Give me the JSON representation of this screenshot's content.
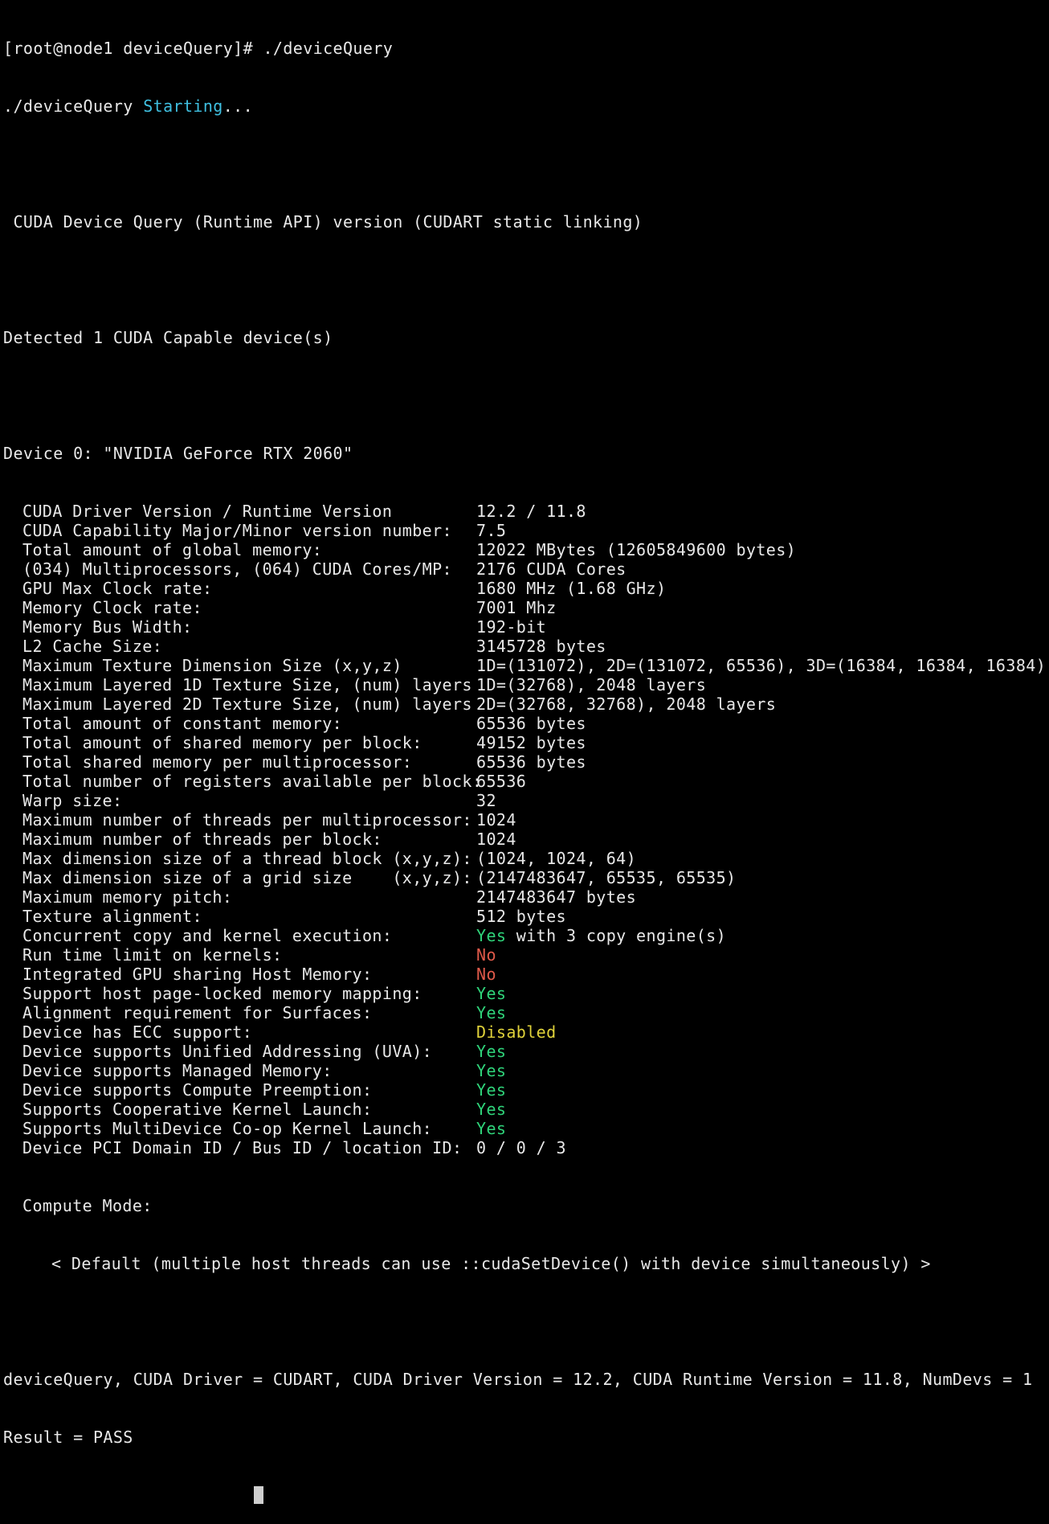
{
  "colors": {
    "background": "#000000",
    "text": "#e8e8e8",
    "cyan": "#3fbfe0",
    "green": "#2fd47a",
    "red": "#e05a4a",
    "yellow": "#e0d23a"
  },
  "prompt": "[root@node1 deviceQuery]# ./deviceQuery",
  "starting": {
    "prefix": "./deviceQuery ",
    "word": "Starting",
    "suffix": "..."
  },
  "header": " CUDA Device Query (Runtime API) version (CUDART static linking)",
  "detected": "Detected 1 CUDA Capable device(s)",
  "device_title": "Device 0: \"NVIDIA GeForce RTX 2060\"",
  "properties": [
    {
      "label": "CUDA Driver Version / Runtime Version",
      "value": "12.2 / 11.8"
    },
    {
      "label": "CUDA Capability Major/Minor version number:",
      "value": "7.5"
    },
    {
      "label": "Total amount of global memory:",
      "value": "12022 MBytes (12605849600 bytes)"
    },
    {
      "label": "(034) Multiprocessors, (064) CUDA Cores/MP:",
      "value": "2176 CUDA Cores"
    },
    {
      "label": "GPU Max Clock rate:",
      "value": "1680 MHz (1.68 GHz)"
    },
    {
      "label": "Memory Clock rate:",
      "value": "7001 Mhz"
    },
    {
      "label": "Memory Bus Width:",
      "value": "192-bit"
    },
    {
      "label": "L2 Cache Size:",
      "value": "3145728 bytes"
    },
    {
      "label": "Maximum Texture Dimension Size (x,y,z)",
      "value": "1D=(131072), 2D=(131072, 65536), 3D=(16384, 16384, 16384)"
    },
    {
      "label": "Maximum Layered 1D Texture Size, (num) layers",
      "value": "1D=(32768), 2048 layers"
    },
    {
      "label": "Maximum Layered 2D Texture Size, (num) layers",
      "value": "2D=(32768, 32768), 2048 layers"
    },
    {
      "label": "Total amount of constant memory:",
      "value": "65536 bytes"
    },
    {
      "label": "Total amount of shared memory per block:",
      "value": "49152 bytes"
    },
    {
      "label": "Total shared memory per multiprocessor:",
      "value": "65536 bytes"
    },
    {
      "label": "Total number of registers available per block:",
      "value": "65536"
    },
    {
      "label": "Warp size:",
      "value": "32"
    },
    {
      "label": "Maximum number of threads per multiprocessor:",
      "value": "1024"
    },
    {
      "label": "Maximum number of threads per block:",
      "value": "1024"
    },
    {
      "label": "Max dimension size of a thread block (x,y,z):",
      "value": "(1024, 1024, 64)"
    },
    {
      "label": "Max dimension size of a grid size    (x,y,z):",
      "value": "(2147483647, 65535, 65535)"
    },
    {
      "label": "Maximum memory pitch:",
      "value": "2147483647 bytes"
    },
    {
      "label": "Texture alignment:",
      "value": "512 bytes"
    },
    {
      "label": "Concurrent copy and kernel execution:",
      "value": "Yes",
      "value_color": "green",
      "value_suffix": " with 3 copy engine(s)"
    },
    {
      "label": "Run time limit on kernels:",
      "value": "No",
      "value_color": "red"
    },
    {
      "label": "Integrated GPU sharing Host Memory:",
      "value": "No",
      "value_color": "red"
    },
    {
      "label": "Support host page-locked memory mapping:",
      "value": "Yes",
      "value_color": "green"
    },
    {
      "label": "Alignment requirement for Surfaces:",
      "value": "Yes",
      "value_color": "green"
    },
    {
      "label": "Device has ECC support:",
      "value": "Disabled",
      "value_color": "yellow"
    },
    {
      "label": "Device supports Unified Addressing (UVA):",
      "value": "Yes",
      "value_color": "green"
    },
    {
      "label": "Device supports Managed Memory:",
      "value": "Yes",
      "value_color": "green"
    },
    {
      "label": "Device supports Compute Preemption:",
      "value": "Yes",
      "value_color": "green"
    },
    {
      "label": "Supports Cooperative Kernel Launch:",
      "value": "Yes",
      "value_color": "green"
    },
    {
      "label": "Supports MultiDevice Co-op Kernel Launch:",
      "value": "Yes",
      "value_color": "green"
    },
    {
      "label": "Device PCI Domain ID / Bus ID / location ID:",
      "value": "0 / 0 / 3"
    }
  ],
  "compute_mode_label": "Compute Mode:",
  "compute_mode_value": "< Default (multiple host threads can use ::cudaSetDevice() with device simultaneously) >",
  "summary": "deviceQuery, CUDA Driver = CUDART, CUDA Driver Version = 12.2, CUDA Runtime Version = 11.8, NumDevs = 1",
  "result": "Result = PASS"
}
